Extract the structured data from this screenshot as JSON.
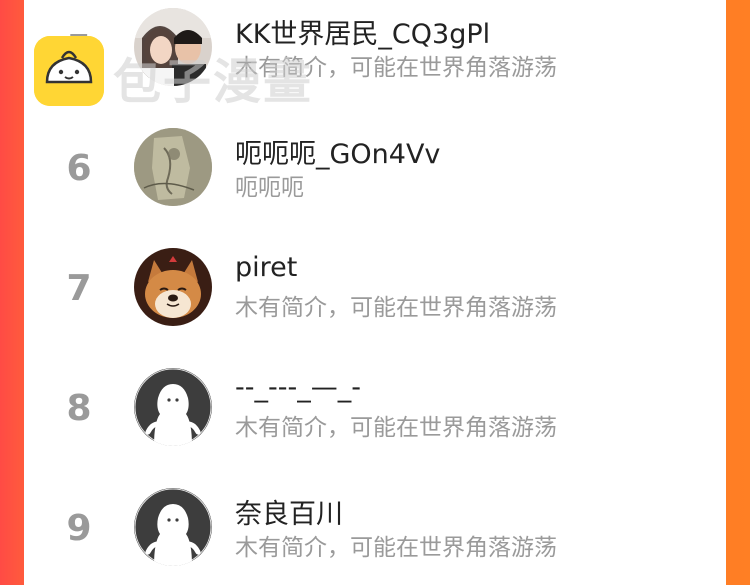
{
  "watermark": {
    "text": "包子漫畫",
    "color": "#ffd634"
  },
  "colors": {
    "background_left": "#ff4b45",
    "background_right": "#ff7f24",
    "rank": "#9a9a9a",
    "name": "#222222",
    "bio": "#9a9a9a"
  },
  "users": [
    {
      "rank": "5",
      "name": "KK世界居民_CQ3gPl",
      "bio": "木有简介，可能在世界角落游荡",
      "avatar": "couple-photo-avatar"
    },
    {
      "rank": "6",
      "name": "呃呃呃_GOn4Vv",
      "bio": "呃呃呃",
      "avatar": "sketch-photo-avatar"
    },
    {
      "rank": "7",
      "name": "piret",
      "bio": "木有简介，可能在世界角落游荡",
      "avatar": "shiba-dog-avatar"
    },
    {
      "rank": "8",
      "name": "--_---_—_-",
      "bio": "木有简介，可能在世界角落游荡",
      "avatar": "default-ghost-avatar"
    },
    {
      "rank": "9",
      "name": "奈良百川",
      "bio": "木有简介，可能在世界角落游荡",
      "avatar": "default-ghost-avatar"
    }
  ]
}
